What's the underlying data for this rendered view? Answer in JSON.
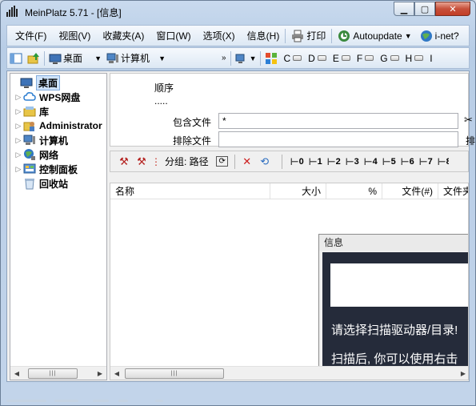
{
  "window": {
    "title": "MeinPlatz 5.71 - [信息]",
    "min_icon": "minimize-icon",
    "max_icon": "maximize-icon",
    "close_icon": "close-icon"
  },
  "menu": {
    "items": [
      "文件(F)",
      "视图(V)",
      "收藏夹(A)",
      "窗口(W)",
      "选项(X)",
      "信息(H)"
    ],
    "print_label": "打印",
    "autoupdate_label": "Autoupdate",
    "inet_label": "i-net?"
  },
  "toolbar": {
    "desktop_label": "桌面",
    "computer_label": "计算机",
    "drives": [
      "C",
      "D",
      "E",
      "F",
      "G",
      "H",
      "I"
    ]
  },
  "tree": {
    "items": [
      {
        "label": "桌面",
        "icon": "desktop-icon"
      },
      {
        "label": "WPS网盘",
        "icon": "cloud-icon"
      },
      {
        "label": "库",
        "icon": "library-icon"
      },
      {
        "label": "Administrator",
        "icon": "user-folder-icon"
      },
      {
        "label": "计算机",
        "icon": "computer-icon"
      },
      {
        "label": "网络",
        "icon": "network-icon"
      },
      {
        "label": "控制面板",
        "icon": "control-panel-icon"
      },
      {
        "label": "回收站",
        "icon": "recycle-bin-icon"
      }
    ]
  },
  "filter": {
    "order_label": "顺序",
    "order_value": ".....",
    "include_label": "包含文件",
    "include_value": "*",
    "exclude_label": "排除文件",
    "exclude_value": "",
    "right_label": "排"
  },
  "file_toolbar": {
    "group_label": "分组: 路径",
    "levels": [
      "0",
      "1",
      "2",
      "3",
      "4",
      "5",
      "6",
      "7",
      "8"
    ]
  },
  "grid": {
    "columns": [
      "名称",
      "大小",
      "%",
      "文件(#)",
      "文件夹"
    ]
  },
  "info": {
    "title": "信息",
    "line1": "请选择扫描驱动器/目录!",
    "line2": "扫描后, 你可以使用右击"
  },
  "colors": {
    "title_bar": "#c9daee",
    "info_dark": "#252b3a",
    "selection": "#cfe3fb"
  }
}
